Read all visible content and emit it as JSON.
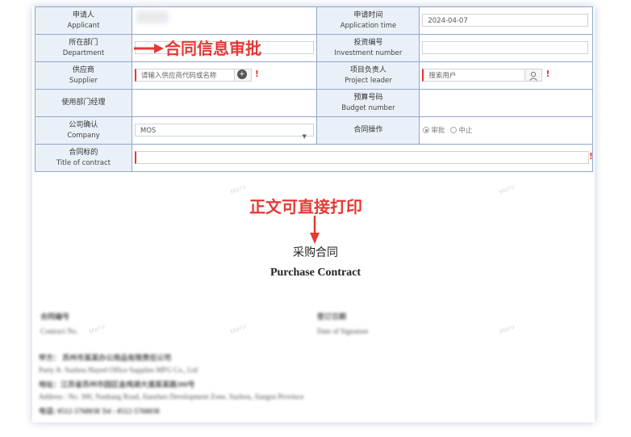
{
  "form": {
    "applicant": {
      "zh": "申请人",
      "en": "Applicant"
    },
    "application_time": {
      "zh": "申请时间",
      "en": "Application time",
      "value": "2024-04-07"
    },
    "department": {
      "zh": "所在部门",
      "en": "Department"
    },
    "investment_number": {
      "zh": "投资编号",
      "en": "Investment number"
    },
    "supplier": {
      "zh": "供应商",
      "en": "Supplier",
      "placeholder": "请输入供应商代码或名称"
    },
    "project_leader": {
      "zh": "项目负责人",
      "en": "Project leader",
      "placeholder": "搜索用户"
    },
    "dept_manager": {
      "zh": "使用部门经理"
    },
    "budget_number": {
      "zh": "预算号码",
      "en": "Budget number"
    },
    "company": {
      "zh": "公司确认",
      "en": "Company",
      "value": "MOS"
    },
    "contract_operation": {
      "zh": "合同操作",
      "options": [
        "审批",
        "中止"
      ]
    },
    "title_of_contract": {
      "zh": "合同标的",
      "en": "Title of contract"
    }
  },
  "annotations": {
    "approval": "合同信息审批",
    "print": "正文可直接打印"
  },
  "document": {
    "title_cn": "采购合同",
    "title_en": "Purchase Contract"
  },
  "colors": {
    "annotation": "#e53935",
    "label_bg": "#eaf0f8",
    "border": "#8ea6cc"
  }
}
